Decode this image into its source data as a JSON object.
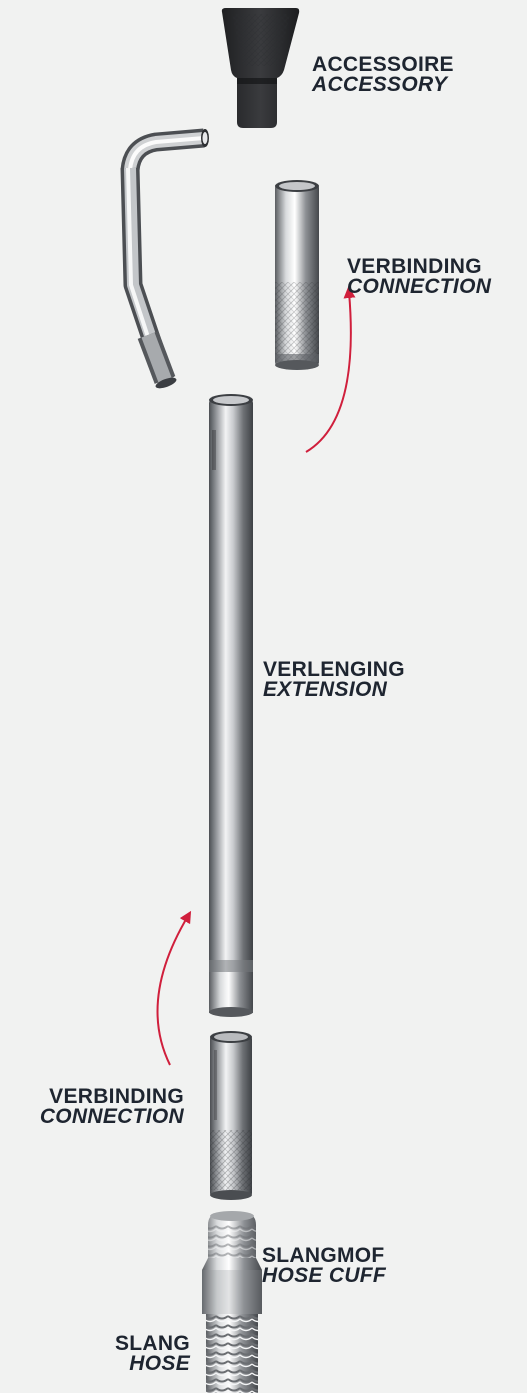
{
  "parts": [
    {
      "id": "accessory",
      "dutch": "ACCESSOIRE",
      "english": "ACCESSORY"
    },
    {
      "id": "connection_top",
      "dutch": "VERBINDING",
      "english": "CONNECTION"
    },
    {
      "id": "extension",
      "dutch": "VERLENGING",
      "english": "EXTENSION"
    },
    {
      "id": "connection_bottom",
      "dutch": "VERBINDING",
      "english": "CONNECTION"
    },
    {
      "id": "hose_cuff",
      "dutch": "SLANGMOF",
      "english": "HOSE CUFF"
    },
    {
      "id": "hose",
      "dutch": "SLANG",
      "english": "HOSE"
    }
  ],
  "colors": {
    "background": "#f1f2f1",
    "label_text": "#1e2530",
    "arrow": "#d01f3c",
    "accessory_body": "#2a2b2d",
    "steel_dark": "#4c4f53",
    "steel_light": "#f2f3f4"
  },
  "icons": [
    "accessory-nozzle-icon",
    "bent-tube-icon",
    "connector-sleeve-icon",
    "extension-tube-icon",
    "hose-cuff-icon",
    "flexible-hose-icon",
    "curved-arrow-icon"
  ]
}
